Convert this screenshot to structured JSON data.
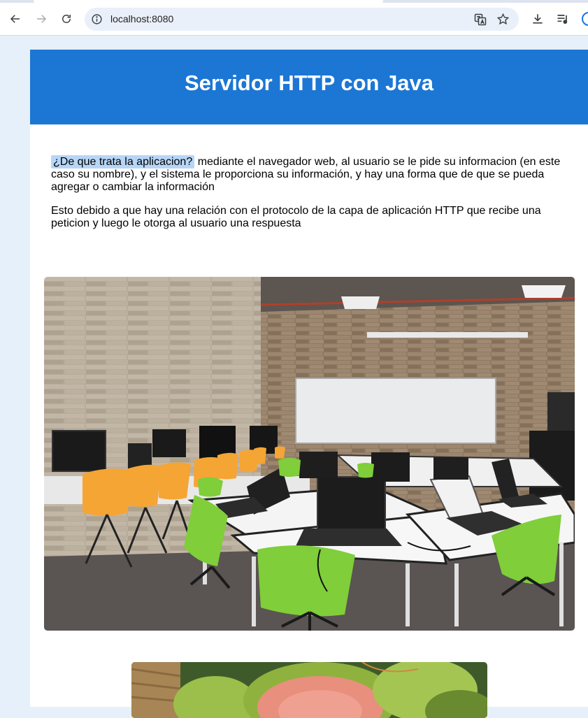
{
  "browser": {
    "url": "localhost:8080",
    "icons": [
      "back-icon",
      "forward-icon",
      "reload-icon",
      "site-info-icon",
      "translate-icon",
      "bookmark-star-icon",
      "download-icon",
      "media-queue-icon",
      "profile-icon"
    ]
  },
  "page": {
    "title": "Servidor HTTP con Java",
    "intro_highlight": "¿De que trata la aplicacion?",
    "intro_text": "mediante el navegador web, al usuario se le pide su informacion (en este caso su nombre), y el sistema le proporciona su información, y hay una forma que de que se pueda agregar o cambiar la información",
    "paragraph2": "Esto debido a que hay una relación con el protocolo de la capa de aplicación HTTP que recibe una peticion y luego le otorga al usuario una respuesta"
  },
  "colors": {
    "header_bg": "#1c76d4",
    "page_bg": "#e6f0fb",
    "highlight": "#b7d6f7",
    "chair_orange": "#f5a534",
    "chair_green": "#7fce3a"
  }
}
